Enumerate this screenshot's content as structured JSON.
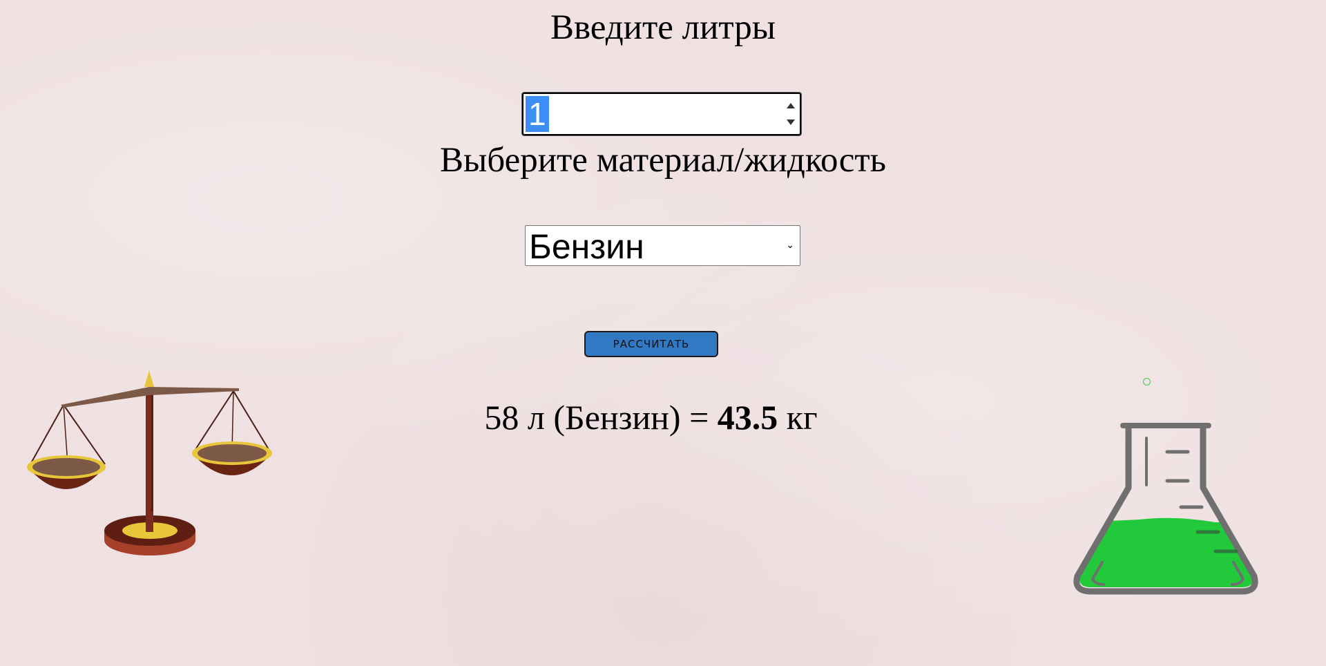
{
  "form": {
    "liters_label": "Введите литры",
    "liters_value": "1",
    "material_label": "Выберите материал/жидкость",
    "material_selected": "Бензин",
    "calculate_button": "РАССЧИТАТЬ"
  },
  "result": {
    "liters": "58",
    "unit_liters": "л",
    "material": "(Бензин)",
    "equals": "=",
    "mass": "43.5",
    "unit_mass": "кг"
  },
  "icons": {
    "scales": "scales-icon",
    "flask": "flask-icon",
    "chevron": "chevron-down-icon"
  },
  "colors": {
    "background": "#efe0e1",
    "button": "#3279c4",
    "selection": "#3d8ff5",
    "flask_liquid": "#22c93a"
  }
}
